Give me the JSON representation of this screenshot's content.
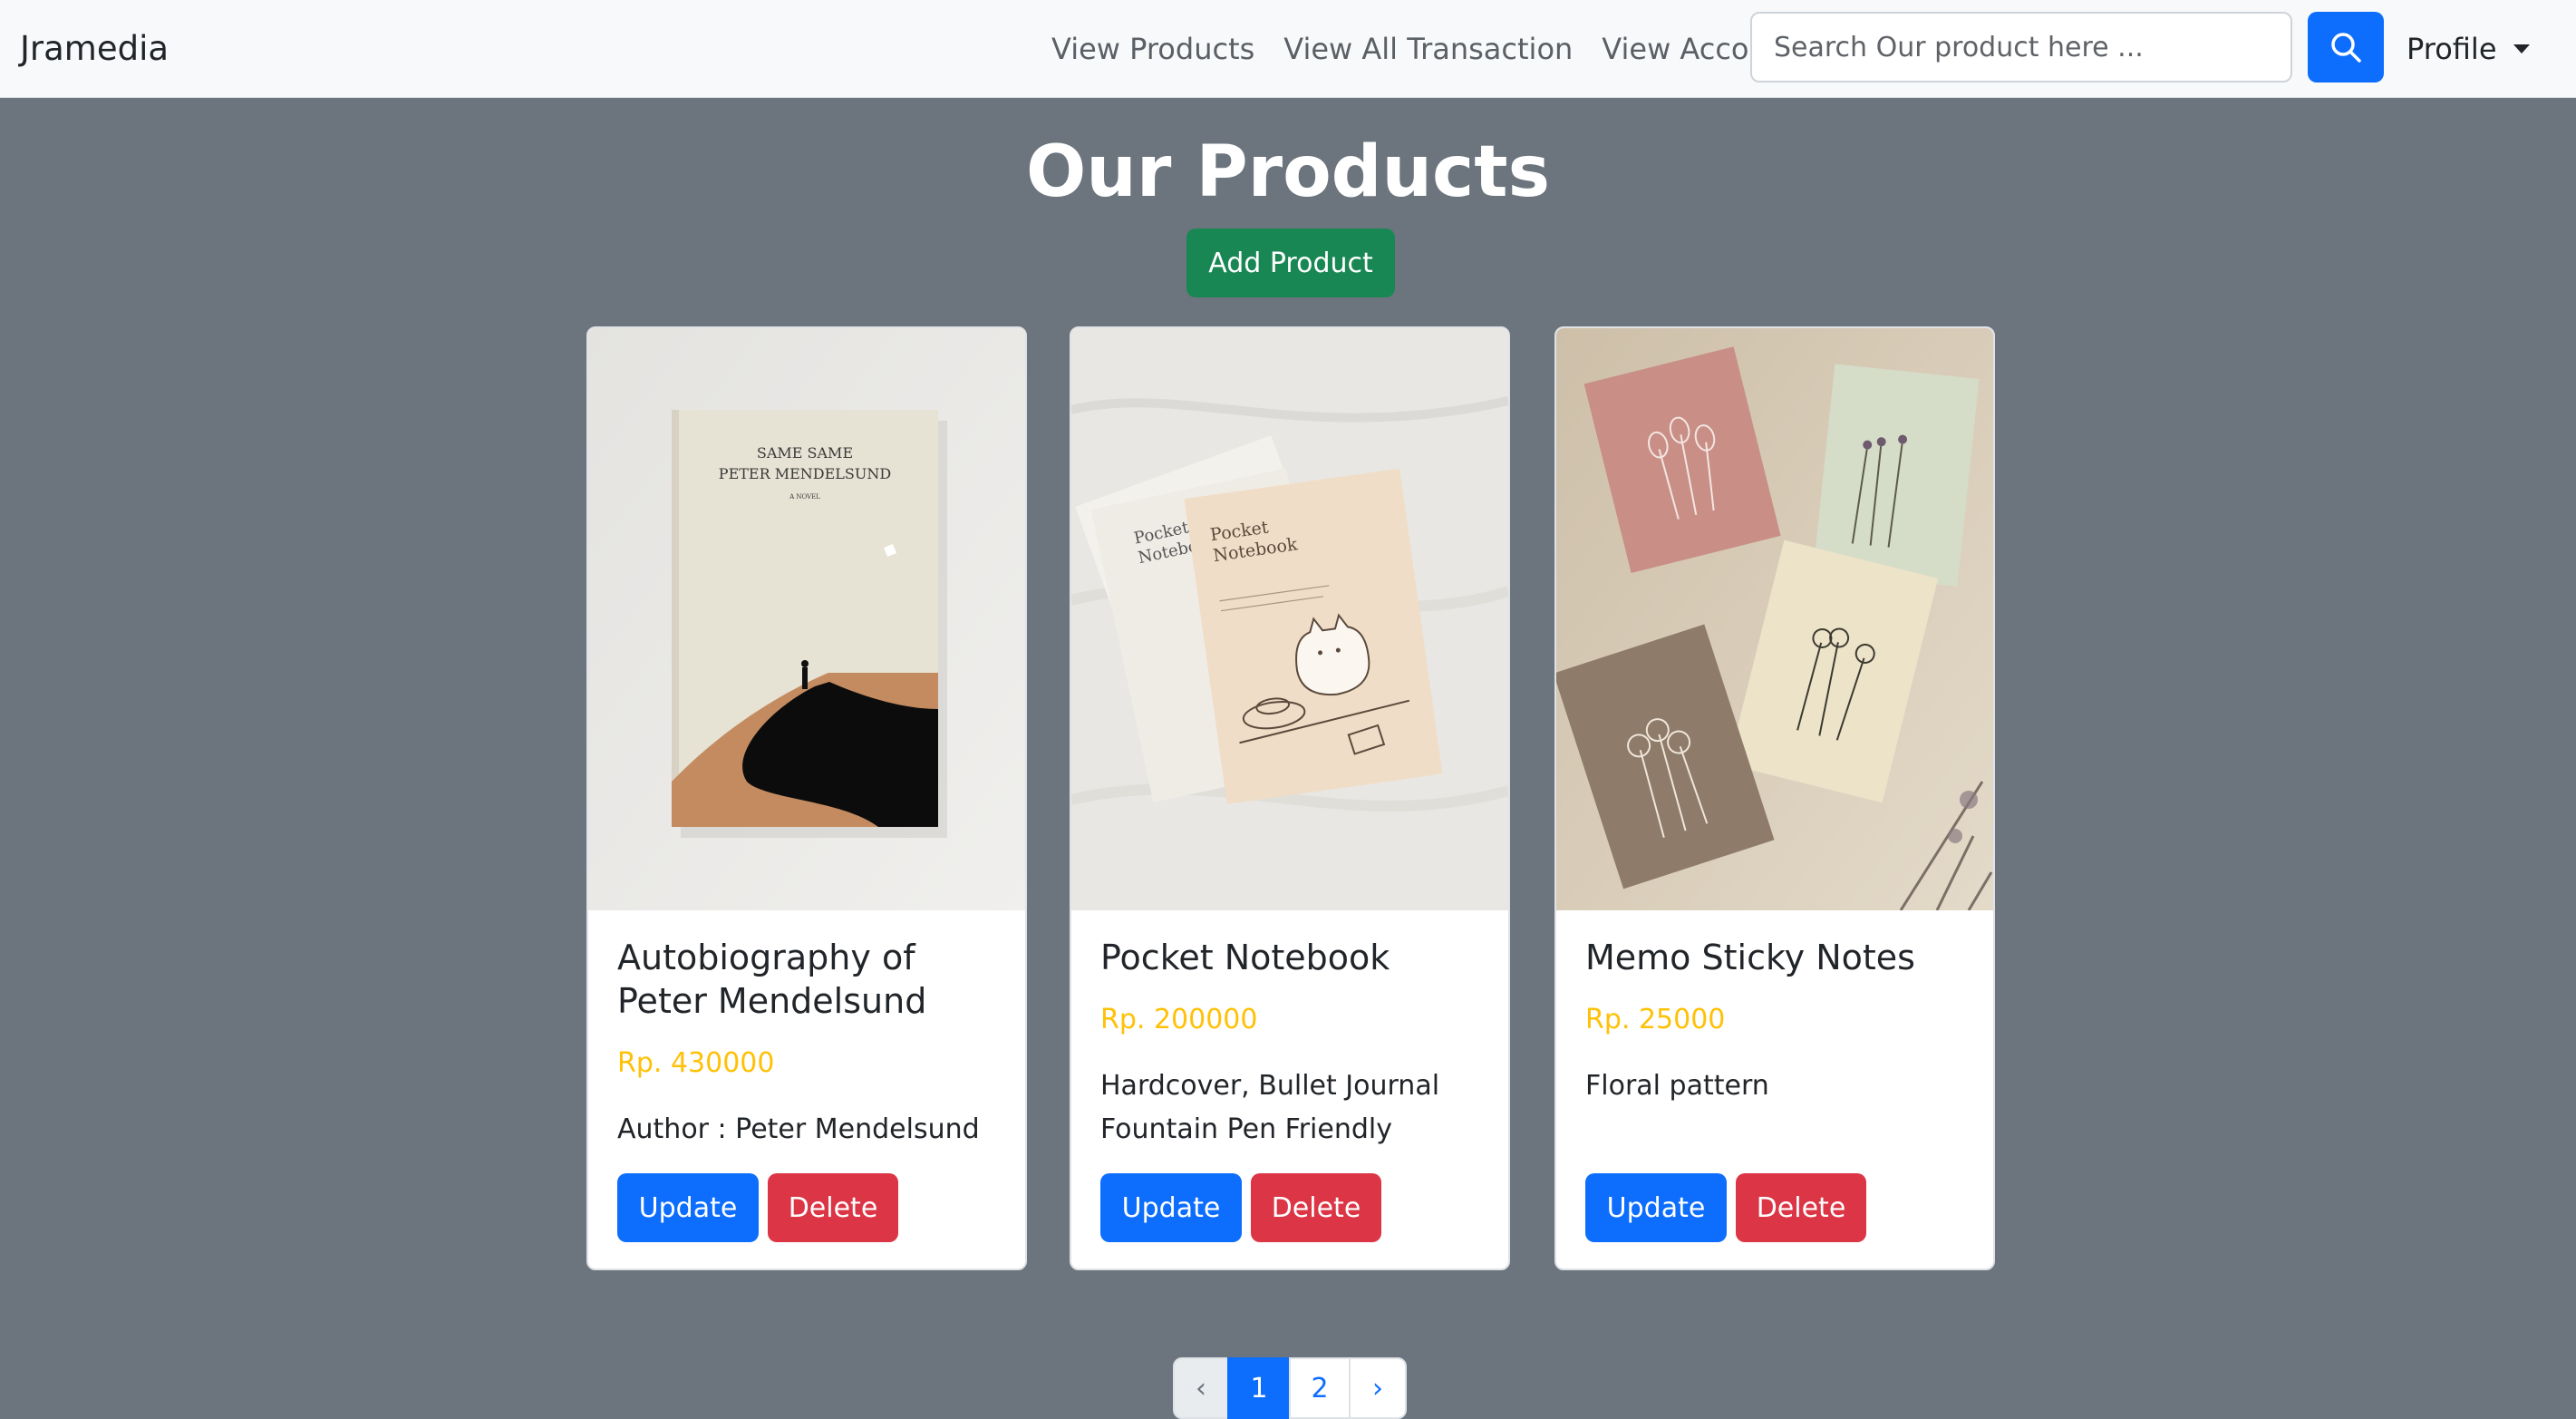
{
  "navbar": {
    "brand": "Jramedia",
    "links": [
      "View Products",
      "View All Transaction",
      "View Account"
    ],
    "search_placeholder": "Search Our product here ...",
    "profile_label": "Profile"
  },
  "header": {
    "title": "Our Products",
    "add_button": "Add Product"
  },
  "products": [
    {
      "title": "Autobiography of Peter Mendelsund",
      "price": "Rp. 430000",
      "description": "Author : Peter Mendelsund",
      "image_text": [
        "SAME SAME",
        "PETER MENDELSUND",
        "A NOVEL"
      ]
    },
    {
      "title": "Pocket Notebook",
      "price": "Rp. 200000",
      "description": "Hardcover, Bullet Journal Fountain Pen Friendly",
      "image_text": [
        "Pocket",
        "Notebook",
        "Pocket",
        "Notebo"
      ]
    },
    {
      "title": "Memo Sticky Notes",
      "price": "Rp. 25000",
      "description": "Floral pattern"
    }
  ],
  "card_buttons": {
    "update": "Update",
    "delete": "Delete"
  },
  "pagination": {
    "prev": "‹",
    "pages": [
      "1",
      "2"
    ],
    "next": "›",
    "active_page": "1"
  },
  "colors": {
    "page_bg": "#6c757d",
    "navbar_bg": "#f8f9fa",
    "primary": "#0d6efd",
    "success": "#198754",
    "danger": "#dc3545",
    "price": "#ffc107"
  },
  "icons": {
    "search": "search-icon",
    "profile_caret": "caret-down-icon"
  }
}
